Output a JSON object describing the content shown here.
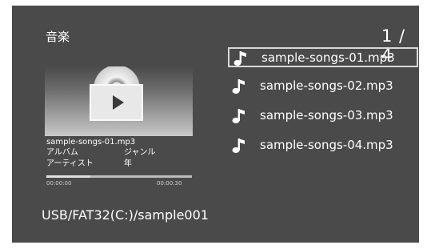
{
  "header": {
    "title": "音楽",
    "page_indicator": "1 / 4"
  },
  "player": {
    "file_name": "sample-songs-01.mp3",
    "album_label": "アルバム",
    "genre_label": "ジャンル",
    "artist_label": "アーティスト",
    "year_label": "年",
    "elapsed": "00:00:00",
    "duration": "00:00:30",
    "progress": 0.3
  },
  "footer": {
    "path": "USB/FAT32(C:)/sample001"
  },
  "playlist": {
    "items": [
      {
        "label": "sample-songs-01.mp3",
        "icon": "music-note-icon",
        "selected": true
      },
      {
        "label": "sample-songs-02.mp3",
        "icon": "music-note-icon",
        "selected": false
      },
      {
        "label": "sample-songs-03.mp3",
        "icon": "music-note-icon",
        "selected": false
      },
      {
        "label": "sample-songs-04.mp3",
        "icon": "music-note-icon",
        "selected": false
      }
    ]
  },
  "colors": {
    "background": "#4a4a4a",
    "text": "#ffffff",
    "selection_border": "#d8d8d8"
  }
}
